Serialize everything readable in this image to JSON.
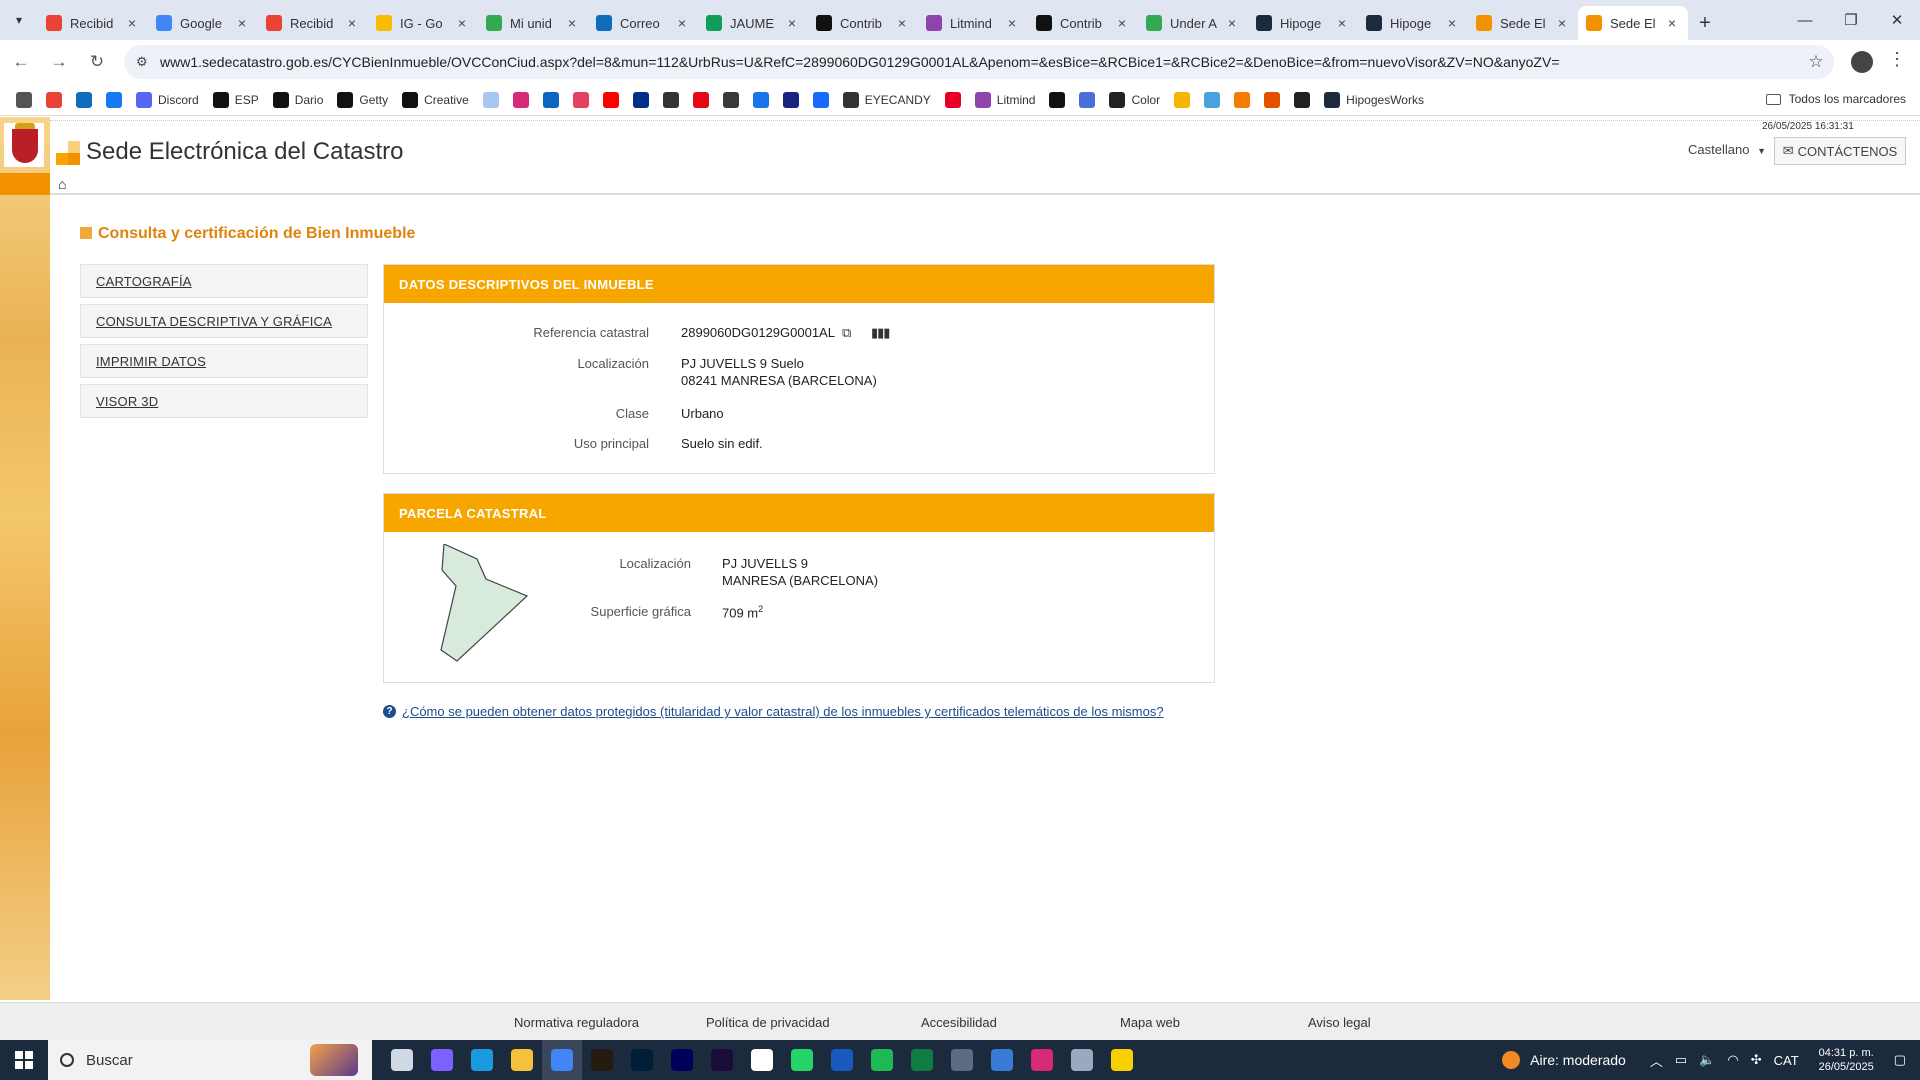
{
  "browser": {
    "tabs": [
      {
        "title": "Recibid",
        "icon": "gmail-icon",
        "color": "#ea4335"
      },
      {
        "title": "Google",
        "icon": "google-icon",
        "color": "#4285f4"
      },
      {
        "title": "Recibid",
        "icon": "gmail-icon",
        "color": "#ea4335"
      },
      {
        "title": "IG - Go",
        "icon": "pinwheel-icon",
        "color": "#fbbc04"
      },
      {
        "title": "Mi unid",
        "icon": "drive-icon",
        "color": "#34a853"
      },
      {
        "title": "Correo",
        "icon": "outlook-icon",
        "color": "#0f6cbd"
      },
      {
        "title": "JAUME",
        "icon": "sheets-icon",
        "color": "#0f9d58"
      },
      {
        "title": "Contrib",
        "icon": "getty-icon",
        "color": "#111111"
      },
      {
        "title": "Litmind",
        "icon": "litmind-icon",
        "color": "#8e44ad"
      },
      {
        "title": "Contrib",
        "icon": "getty-icon",
        "color": "#111111"
      },
      {
        "title": "Under A",
        "icon": "maps-icon",
        "color": "#34a853"
      },
      {
        "title": "Hipoge",
        "icon": "hipoges-icon",
        "color": "#1c2a3e"
      },
      {
        "title": "Hipoge",
        "icon": "hipoges-icon",
        "color": "#1c2a3e"
      },
      {
        "title": "Sede El",
        "icon": "catastro-icon",
        "color": "#f39200"
      },
      {
        "title": "Sede El",
        "icon": "catastro-icon",
        "color": "#f39200"
      }
    ],
    "url": "www1.sedecatastro.gob.es/CYCBienInmueble/OVCConCiud.aspx?del=8&mun=112&UrbRus=U&RefC=2899060DG0129G0001AL&Apenom=&esBice=&RCBice1=&RCBice2=&DenoBice=&from=nuevoVisor&ZV=NO&anyoZV=",
    "bookmarks": [
      {
        "label": "",
        "icon": "apps-icon",
        "color": "#555555"
      },
      {
        "label": "",
        "icon": "gmail-icon",
        "color": "#ea4335"
      },
      {
        "label": "",
        "icon": "outlook-icon",
        "color": "#0f6cbd"
      },
      {
        "label": "",
        "icon": "facebook-icon",
        "color": "#1877f2"
      },
      {
        "label": "Discord",
        "icon": "discord-icon",
        "color": "#5865f2"
      },
      {
        "label": "ESP",
        "icon": "getty-icon",
        "color": "#111111"
      },
      {
        "label": "Dario",
        "icon": "s-icon",
        "color": "#111111"
      },
      {
        "label": "Getty",
        "icon": "getty-icon",
        "color": "#111111"
      },
      {
        "label": "Creative",
        "icon": "getty-icon",
        "color": "#111111"
      },
      {
        "label": "",
        "icon": "messenger-icon",
        "color": "#a7c7f2"
      },
      {
        "label": "",
        "icon": "instagram-icon",
        "color": "#d62976"
      },
      {
        "label": "",
        "icon": "linkedin-icon",
        "color": "#0a66c2"
      },
      {
        "label": "",
        "icon": "behance-icon",
        "color": "#e4405f"
      },
      {
        "label": "",
        "icon": "youtube-icon",
        "color": "#ff0000"
      },
      {
        "label": "",
        "icon": "paypal-icon",
        "color": "#003087"
      },
      {
        "label": "",
        "icon": "cube-icon",
        "color": "#333333"
      },
      {
        "label": "",
        "icon": "netflix-icon",
        "color": "#e50914"
      },
      {
        "label": "",
        "icon": "wave-icon",
        "color": "#3a3a3a"
      },
      {
        "label": "",
        "icon": "play-icon",
        "color": "#1a73e8"
      },
      {
        "label": "",
        "icon": "m-icon",
        "color": "#1a237e"
      },
      {
        "label": "",
        "icon": "behance-icon",
        "color": "#1769ff"
      },
      {
        "label": "EYECANDY",
        "icon": "eye-icon",
        "color": "#333333"
      },
      {
        "label": "",
        "icon": "pinterest-icon",
        "color": "#e60023"
      },
      {
        "label": "Litmind",
        "icon": "litmind-icon",
        "color": "#8e44ad"
      },
      {
        "label": "",
        "icon": "j-icon",
        "color": "#111111"
      },
      {
        "label": "",
        "icon": "circle-icon",
        "color": "#4a6fd9"
      },
      {
        "label": "Color",
        "icon": "color-icon",
        "color": "#222222"
      },
      {
        "label": "",
        "icon": "dot-icon",
        "color": "#f4b400"
      },
      {
        "label": "",
        "icon": "ring-icon",
        "color": "#4aa3df"
      },
      {
        "label": "",
        "icon": "orange-icon",
        "color": "#f57c00"
      },
      {
        "label": "",
        "icon": "bk-icon",
        "color": "#e65100"
      },
      {
        "label": "",
        "icon": "spiral-icon",
        "color": "#222222"
      },
      {
        "label": "HipogesWorks",
        "icon": "hipoges-icon",
        "color": "#1c2a3e"
      }
    ],
    "all_bookmarks": "Todos los marcadores"
  },
  "site": {
    "datetime": "26/05/2025  16:31:31",
    "title": "Sede Electrónica del Catastro",
    "language": "Castellano",
    "contact": "CONTÁCTENOS",
    "page_heading": "Consulta y certificación de Bien Inmueble",
    "menu": [
      "CARTOGRAFÍA",
      "CONSULTA DESCRIPTIVA Y GRÁFICA",
      "IMPRIMIR DATOS",
      "VISOR 3D"
    ],
    "descriptive": {
      "header": "DATOS DESCRIPTIVOS DEL INMUEBLE",
      "ref_label": "Referencia catastral",
      "ref_value": "2899060DG0129G0001AL",
      "loc_label": "Localización",
      "loc_line1": "PJ JUVELLS 9 Suelo",
      "loc_line2": "08241 MANRESA (BARCELONA)",
      "class_label": "Clase",
      "class_value": "Urbano",
      "use_label": "Uso principal",
      "use_value": "Suelo sin edif."
    },
    "parcel": {
      "header": "PARCELA CATASTRAL",
      "loc_label": "Localización",
      "loc_line1": "PJ JUVELLS 9",
      "loc_line2": "MANRESA (BARCELONA)",
      "area_label": "Superficie gráfica",
      "area_value": "709 m",
      "area_unit_sup": "2"
    },
    "help_link": "¿Cómo se pueden obtener datos protegidos (titularidad y valor catastral) de los inmuebles y certificados telemáticos de los mismos?",
    "footer": [
      "Normativa reguladora",
      "Política de privacidad",
      "Accesibilidad",
      "Mapa web",
      "Aviso legal"
    ]
  },
  "taskbar": {
    "search": "Buscar",
    "weather": "Aire: moderado",
    "lang": "CAT",
    "time": "04:31 p. m.",
    "date": "26/05/2025",
    "apps": [
      {
        "icon": "task-view-icon",
        "color": "#cfd8e3"
      },
      {
        "icon": "copilot-icon",
        "color": "#7b61ff"
      },
      {
        "icon": "edge-icon",
        "color": "#1a9be0"
      },
      {
        "icon": "file-explorer-icon",
        "color": "#f3c13a"
      },
      {
        "icon": "chrome-icon",
        "color": "#4285f4"
      },
      {
        "icon": "bridge-icon",
        "color": "#241a10"
      },
      {
        "icon": "photoshop-icon",
        "color": "#001e36"
      },
      {
        "icon": "premiere-icon",
        "color": "#00005b"
      },
      {
        "icon": "rush-icon",
        "color": "#1a0d3a"
      },
      {
        "icon": "snipping-icon",
        "color": "#ffffff"
      },
      {
        "icon": "whatsapp-icon",
        "color": "#25d366"
      },
      {
        "icon": "word-icon",
        "color": "#185abd"
      },
      {
        "icon": "spotify-icon",
        "color": "#1db954"
      },
      {
        "icon": "excel-icon",
        "color": "#107c41"
      },
      {
        "icon": "calculator-icon",
        "color": "#5a6b82"
      },
      {
        "icon": "maps-app-icon",
        "color": "#3a7bd5"
      },
      {
        "icon": "instagram-app-icon",
        "color": "#d62976"
      },
      {
        "icon": "3d-viewer-icon",
        "color": "#9aa8c0"
      },
      {
        "icon": "sticky-notes-icon",
        "color": "#f7d000"
      }
    ]
  },
  "colors": {
    "accent": "#f7a600",
    "heading": "#e0830a",
    "link": "#1f4d8a",
    "parcel_fill": "#d8eadc"
  }
}
